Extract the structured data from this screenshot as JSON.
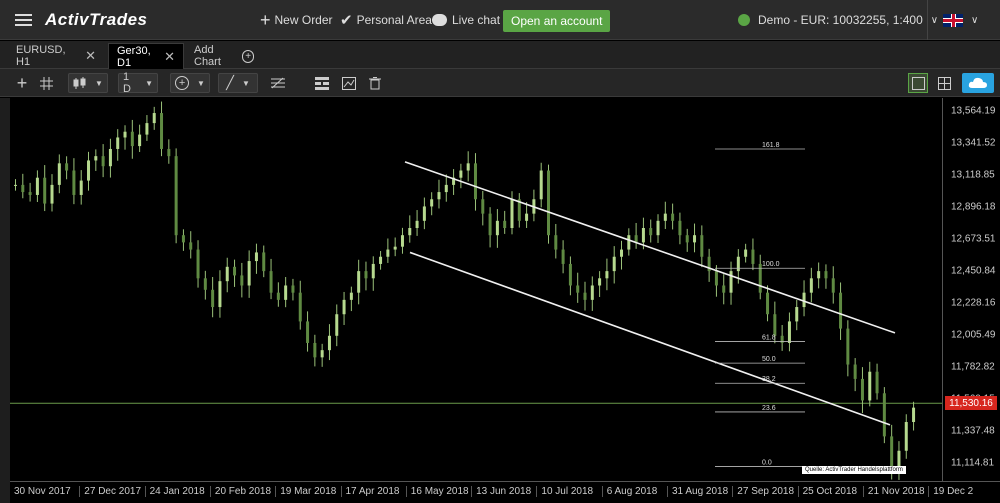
{
  "topbar": {
    "logo": "ActivTrades",
    "new_order": "New Order",
    "personal_area": "Personal Area",
    "live_chat": "Live chat",
    "open_account": "Open an account",
    "account": "Demo - EUR: 10032255, 1:400"
  },
  "tabs": [
    {
      "label": "EURUSD, H1"
    },
    {
      "label": "Ger30, D1"
    },
    {
      "label": "Add Chart"
    }
  ],
  "toolbar": {
    "timeframe": "1 D"
  },
  "chart_data": {
    "type": "candlestick",
    "symbol": "Ger30",
    "timeframe": "D1",
    "x_labels": [
      "30 Nov 2017",
      "27 Dec 2017",
      "24 Jan 2018",
      "20 Feb 2018",
      "19 Mar 2018",
      "17 Apr 2018",
      "16 May 2018",
      "13 Jun 2018",
      "10 Jul 2018",
      "6 Aug 2018",
      "31 Aug 2018",
      "27 Sep 2018",
      "25 Oct 2018",
      "21 Nov 2018",
      "19 Dec 2"
    ],
    "y_ticks": [
      "13,564.19",
      "13,341.52",
      "13,118.85",
      "12,896.18",
      "12,673.51",
      "12,450.84",
      "12,228.16",
      "12,005.49",
      "11,782.82",
      "11,560.15",
      "11,337.48",
      "11,114.81"
    ],
    "y_values": [
      13564.19,
      13341.52,
      13118.85,
      12896.18,
      12673.51,
      12450.84,
      12228.16,
      12005.49,
      11782.82,
      11560.15,
      11337.48,
      11114.81
    ],
    "last_price": "11,530.16",
    "last_price_value": 11530.16,
    "fibonacci_levels": [
      "161.8",
      "100.0",
      "61.8",
      "50.0",
      "38.2",
      "23.6",
      "0.0"
    ],
    "fibonacci_prices": [
      13300,
      12470,
      11960,
      11810,
      11670,
      11470,
      11090
    ],
    "closes": [
      13050,
      13000,
      12980,
      13100,
      12920,
      13050,
      13200,
      13150,
      12980,
      13080,
      13220,
      13250,
      13180,
      13300,
      13380,
      13420,
      13320,
      13400,
      13480,
      13550,
      13300,
      13250,
      12700,
      12650,
      12600,
      12400,
      12320,
      12200,
      12380,
      12480,
      12420,
      12350,
      12520,
      12580,
      12450,
      12300,
      12250,
      12350,
      12300,
      12100,
      11950,
      11850,
      11900,
      12000,
      12150,
      12250,
      12300,
      12450,
      12400,
      12500,
      12550,
      12600,
      12620,
      12700,
      12750,
      12800,
      12900,
      12950,
      13000,
      13050,
      13100,
      13150,
      13200,
      12950,
      12850,
      12700,
      12800,
      12750,
      12950,
      12800,
      12850,
      12950,
      13150,
      12700,
      12600,
      12500,
      12350,
      12300,
      12250,
      12350,
      12400,
      12450,
      12550,
      12600,
      12700,
      12650,
      12750,
      12700,
      12800,
      12850,
      12800,
      12700,
      12650,
      12700,
      12550,
      12450,
      12350,
      12300,
      12450,
      12550,
      12600,
      12500,
      12300,
      12150,
      12000,
      11950,
      12100,
      12200,
      12300,
      12400,
      12450,
      12400,
      12300,
      12050,
      11800,
      11700,
      11550,
      11750,
      11600,
      11300,
      11050,
      11200,
      11400,
      11500
    ],
    "channel": {
      "upper": [
        {
          "i": 86,
          "p": 13210
        },
        {
          "i": 200,
          "p": 12020
        }
      ],
      "lower": [
        {
          "i": 86,
          "p": 12580
        },
        {
          "i": 200,
          "p": 11380
        }
      ]
    },
    "source": "Quelle: ActivTrader Handelsplattform"
  }
}
